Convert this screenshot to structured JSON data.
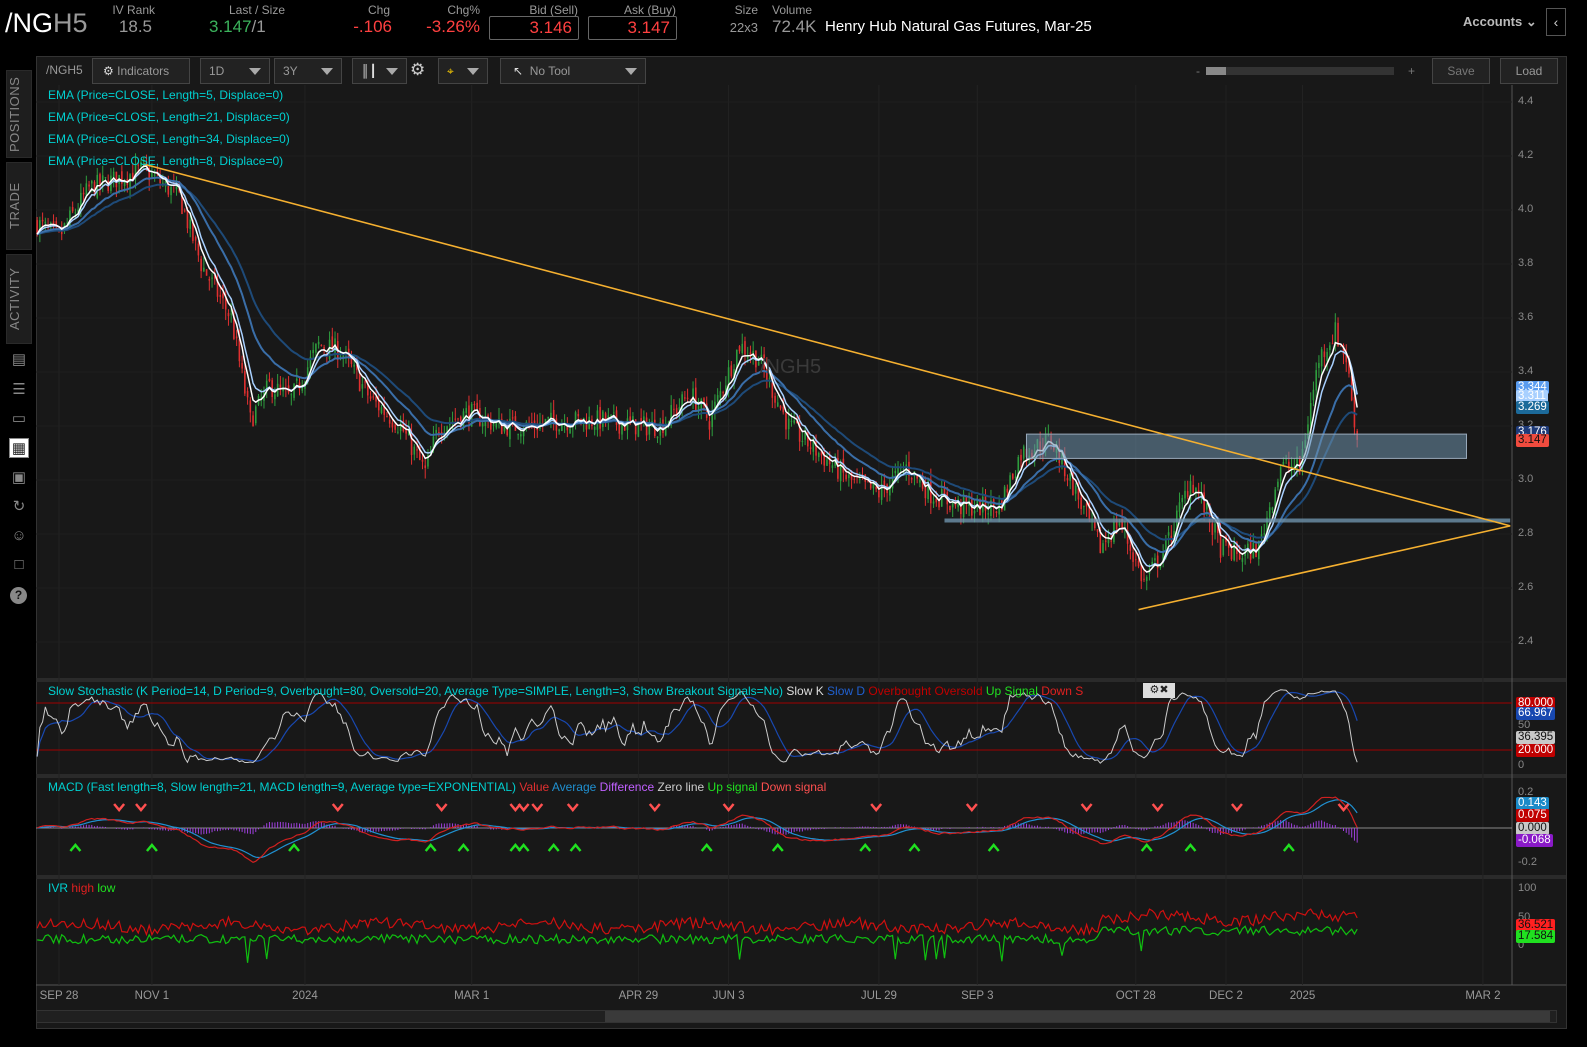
{
  "header": {
    "symbol_main": "/NG",
    "symbol_month": "H5",
    "iv_rank_label": "IV Rank",
    "iv_rank": "18.5",
    "last_label": "Last / Size",
    "last": "3.147",
    "last_size": "/1",
    "chg_label": "Chg",
    "chg": "-.106",
    "chgpct_label": "Chg%",
    "chgpct": "-3.26%",
    "bid_label": "Bid (Sell)",
    "bid": "3.146",
    "ask_label": "Ask (Buy)",
    "ask": "3.147",
    "size_label": "Size",
    "size": "22x3",
    "volume_label": "Volume",
    "volume": "72.4K",
    "description": "Henry Hub Natural Gas Futures, Mar-25",
    "accounts": "Accounts"
  },
  "toolbar": {
    "symbol": "/NGH5",
    "indicators": "Indicators",
    "aggregation": "1D",
    "timeframe": "3Y",
    "tool": "No Tool",
    "zoom_minus": "-",
    "zoom_plus": "+",
    "save": "Save",
    "load": "Load"
  },
  "sidebar": {
    "tabs": [
      "POSITIONS",
      "TRADE",
      "ACTIVITY"
    ]
  },
  "legends": {
    "ema": [
      "EMA (Price=CLOSE, Length=5, Displace=0)",
      "EMA (Price=CLOSE, Length=21, Displace=0)",
      "EMA (Price=CLOSE, Length=34, Displace=0)",
      "EMA (Price=CLOSE, Length=8, Displace=0)"
    ],
    "stoch": "Slow Stochastic (K Period=14, D Period=9, Overbought=80, Oversold=20, Average Type=SIMPLE, Length=3, Show Breakout Signals=No)",
    "stoch_items": [
      "Slow K",
      "Slow D",
      "Overbought",
      "Oversold",
      "Up Signal",
      "Down S"
    ],
    "macd": "MACD (Fast length=8, Slow length=21, MACD length=9, Average type=EXPONENTIAL)",
    "macd_items": [
      "Value",
      "Average",
      "Difference",
      "Zero line",
      "Up signal",
      "Down signal"
    ],
    "ivr": "IVR",
    "ivr_items": [
      "high",
      "low"
    ]
  },
  "watermark": "/NGH5",
  "colors": {
    "up": "#2e9e3e",
    "down": "#e03030",
    "ema5": "#ffffff",
    "ema8": "#a8d0ff",
    "ema21": "#3a6ea8",
    "ema34": "#1e4a78",
    "trend": "#f5b030",
    "zone": "#6f93ad"
  },
  "chart_data": {
    "type": "candlestick",
    "x_unit": "calendar days since 2023-09-28",
    "x_ticks": [
      {
        "d": 0,
        "label": "SEP 28"
      },
      {
        "d": 34,
        "label": "NOV 1"
      },
      {
        "d": 90,
        "label": "2024"
      },
      {
        "d": 151,
        "label": "MAR 1"
      },
      {
        "d": 212,
        "label": "APR 29"
      },
      {
        "d": 245,
        "label": "JUN 3"
      },
      {
        "d": 300,
        "label": "JUL 29"
      },
      {
        "d": 336,
        "label": "SEP 3"
      },
      {
        "d": 394,
        "label": "OCT 28"
      },
      {
        "d": 427,
        "label": "DEC 2"
      },
      {
        "d": 455,
        "label": "2025"
      },
      {
        "d": 521,
        "label": "MAR 2"
      }
    ],
    "x_range": [
      -8,
      531
    ],
    "price_axis": {
      "range": [
        2.3,
        4.45
      ],
      "ticks": [
        "4.4",
        "4.2",
        "4.0",
        "3.8",
        "3.6",
        "3.4",
        "3.2",
        "3.0",
        "2.8",
        "2.6",
        "2.4"
      ]
    },
    "close_path": [
      [
        -8,
        3.95
      ],
      [
        0,
        3.9
      ],
      [
        11,
        4.08
      ],
      [
        31,
        4.15
      ],
      [
        44,
        4.05
      ],
      [
        52,
        3.8
      ],
      [
        63,
        3.6
      ],
      [
        70,
        3.22
      ],
      [
        77,
        3.35
      ],
      [
        85,
        3.3
      ],
      [
        95,
        3.5
      ],
      [
        103,
        3.48
      ],
      [
        114,
        3.3
      ],
      [
        125,
        3.2
      ],
      [
        134,
        3.03
      ],
      [
        139,
        3.2
      ],
      [
        150,
        3.25
      ],
      [
        161,
        3.2
      ],
      [
        172,
        3.2
      ],
      [
        183,
        3.22
      ],
      [
        198,
        3.22
      ],
      [
        213,
        3.2
      ],
      [
        220,
        3.2
      ],
      [
        231,
        3.32
      ],
      [
        238,
        3.22
      ],
      [
        249,
        3.5
      ],
      [
        256,
        3.45
      ],
      [
        267,
        3.2
      ],
      [
        278,
        3.1
      ],
      [
        289,
        3.0
      ],
      [
        300,
        2.95
      ],
      [
        310,
        3.05
      ],
      [
        319,
        2.95
      ],
      [
        330,
        2.9
      ],
      [
        344,
        2.9
      ],
      [
        352,
        3.1
      ],
      [
        363,
        3.15
      ],
      [
        370,
        3.0
      ],
      [
        381,
        2.75
      ],
      [
        388,
        2.85
      ],
      [
        397,
        2.62
      ],
      [
        405,
        2.75
      ],
      [
        414,
        3.0
      ],
      [
        417,
        2.95
      ],
      [
        425,
        2.75
      ],
      [
        432,
        2.72
      ],
      [
        439,
        2.75
      ],
      [
        447,
        3.05
      ],
      [
        454,
        3.05
      ],
      [
        461,
        3.45
      ],
      [
        467,
        3.55
      ],
      [
        471,
        3.45
      ],
      [
        475,
        3.15
      ]
    ],
    "annotations": {
      "downtrend": [
        [
          31,
          4.17
        ],
        [
          531,
          2.83
        ]
      ],
      "uptrend": [
        [
          395,
          2.52
        ],
        [
          531,
          2.83
        ]
      ],
      "resistance_zone": {
        "from": 354,
        "to": 515,
        "low": 3.08,
        "high": 3.17
      },
      "support_line": {
        "from": 324,
        "to": 531,
        "value": 2.85
      }
    },
    "price_tags": [
      {
        "label": "3.344",
        "value": 3.344,
        "bg": "#5a9cf0"
      },
      {
        "label": "3.311",
        "value": 3.311,
        "bg": "#a8d0ff"
      },
      {
        "label": "3.269",
        "value": 3.269,
        "bg": "#1c6a9a"
      },
      {
        "label": "3.176",
        "value": 3.176,
        "bg": "#1e3a78"
      },
      {
        "label": "3.147",
        "value": 3.147,
        "bg": "#f04b3e"
      }
    ],
    "stoch": {
      "range": [
        0,
        100
      ],
      "ticks": [
        "50",
        "0"
      ],
      "tags": [
        {
          "label": "80.000",
          "value": 80,
          "bg": "#c00000"
        },
        {
          "label": "66.967",
          "value": 66.967,
          "bg": "#1848b0"
        },
        {
          "label": "36.395",
          "value": 36.395,
          "bg": "#c8c8c8"
        },
        {
          "label": "20.000",
          "value": 20,
          "bg": "#c00000"
        }
      ]
    },
    "macd": {
      "range": [
        -0.26,
        0.26
      ],
      "ticks": [
        "0.2",
        "-0.2"
      ],
      "tags": [
        {
          "label": "0.143",
          "value": 0.143,
          "bg": "#1a8ac8"
        },
        {
          "label": "0.075",
          "value": 0.075,
          "bg": "#c00000"
        },
        {
          "label": "0.000",
          "value": 0,
          "bg": "#c8c8c8"
        },
        {
          "label": "-0.068",
          "value": -0.068,
          "bg": "#8a1ac8"
        }
      ],
      "down_signals": [
        22,
        30,
        102,
        140,
        167,
        170,
        175,
        188,
        218,
        245,
        299,
        334,
        376,
        402,
        431,
        470
      ],
      "up_signals": [
        6,
        34,
        86,
        136,
        148,
        167,
        170,
        181,
        189,
        237,
        263,
        295,
        313,
        342,
        398,
        414,
        450
      ]
    },
    "ivr": {
      "range": [
        -15,
        105
      ],
      "ticks": [
        "100",
        "50",
        "0"
      ],
      "tags": [
        {
          "label": "36.521",
          "value": 36.521,
          "bg": "#ff2020"
        },
        {
          "label": "17.584",
          "value": 17.584,
          "bg": "#20e020"
        }
      ]
    }
  }
}
